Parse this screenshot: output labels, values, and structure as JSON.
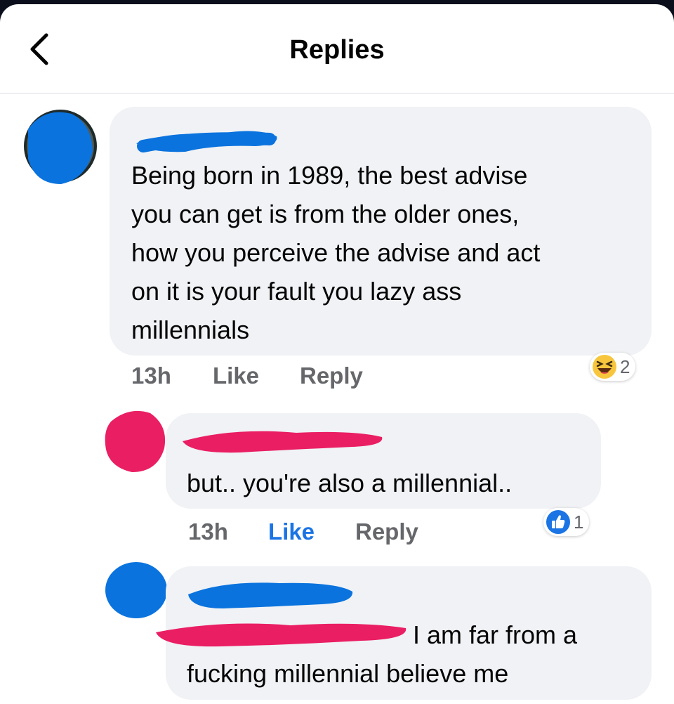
{
  "header": {
    "title": "Replies",
    "back_icon": "chevron-left-icon"
  },
  "comments": [
    {
      "author_obscured": true,
      "text": "Being born in 1989, the best advise\nyou can get is from the older ones,\nhow you perceive the advise and act\non it is your fault you lazy ass\nmillennials",
      "time": "13h",
      "like_label": "Like",
      "reply_label": "Reply",
      "reaction": {
        "icon": "laughing-emoji-icon",
        "count": "2"
      },
      "liked": false
    },
    {
      "author_obscured": true,
      "text": "but.. you're also a millennial..",
      "time": "13h",
      "like_label": "Like",
      "reply_label": "Reply",
      "reaction": {
        "icon": "thumbs-up-icon",
        "count": "1"
      },
      "liked": true
    },
    {
      "author_obscured": true,
      "text": "I am far from a\nfucking millennial believe me"
    }
  ],
  "colors": {
    "like_active": "#1b74e4",
    "meta_gray": "#65676b",
    "bubble_bg": "#f0f2f5",
    "redaction_blue": "#0a73de",
    "redaction_pink": "#ea1e63"
  }
}
